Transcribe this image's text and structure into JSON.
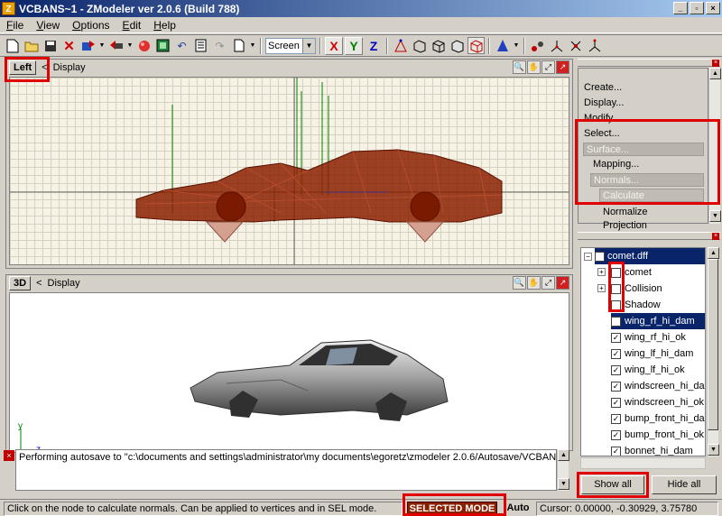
{
  "window": {
    "title": "VCBANS~1 - ZModeler ver 2.0.6 (Build 788)",
    "app_icon": "Z"
  },
  "menu": [
    {
      "label": "File",
      "u": "F",
      "rest": "ile"
    },
    {
      "label": "View",
      "u": "V",
      "rest": "iew"
    },
    {
      "label": "Options",
      "u": "O",
      "rest": "ptions"
    },
    {
      "label": "Edit",
      "u": "E",
      "rest": "dit"
    },
    {
      "label": "Help",
      "u": "H",
      "rest": "elp"
    }
  ],
  "toolbar": {
    "coord_mode": "Screen",
    "axis_x": "X",
    "axis_y": "Y",
    "axis_z": "Z"
  },
  "viewport_top": {
    "label": "Left",
    "display_label": "Display"
  },
  "viewport_bottom": {
    "label": "3D",
    "display_label": "Display"
  },
  "commands": {
    "create": "Create...",
    "display": "Display...",
    "modify": "Modify...",
    "select": "Select...",
    "surface": "Surface...",
    "mapping": "Mapping...",
    "normals": "Normals...",
    "calculate": "Calculate",
    "normalize": "Normalize",
    "projection": "Projection"
  },
  "tree": {
    "root": "comet.dff",
    "items": [
      {
        "label": "comet",
        "checked": false,
        "expandable": true
      },
      {
        "label": "Collision",
        "checked": false,
        "expandable": true
      },
      {
        "label": "Shadow",
        "checked": false,
        "expandable": false
      },
      {
        "label": "wing_rf_hi_dam",
        "checked": true,
        "selected": true
      },
      {
        "label": "wing_rf_hi_ok",
        "checked": true
      },
      {
        "label": "wing_lf_hi_dam",
        "checked": true
      },
      {
        "label": "wing_lf_hi_ok",
        "checked": true
      },
      {
        "label": "windscreen_hi_dam",
        "checked": true
      },
      {
        "label": "windscreen_hi_ok",
        "checked": true
      },
      {
        "label": "bump_front_hi_dam",
        "checked": true
      },
      {
        "label": "bump_front_hi_ok",
        "checked": true
      },
      {
        "label": "bonnet_hi_dam",
        "checked": true
      }
    ]
  },
  "buttons": {
    "show_all": "Show all",
    "hide_all": "Hide all"
  },
  "log": {
    "message": "Performing autosave to \"c:\\documents and settings\\administrator\\my documents\\egoretz\\zmodeler 2.0.6/Autosave/VCBANS"
  },
  "status": {
    "hint": "Click on the node to calculate normals. Can be applied to vertices and in SEL mode.",
    "mode": "SELECTED MODE",
    "auto": "Auto",
    "cursor": "Cursor: 0.00000, -0.30929, 3.75780"
  },
  "colors": {
    "title_start": "#0a246a",
    "title_end": "#a6caf0",
    "selection": "#0a246a",
    "highlight": "#e00000",
    "wireframe": "#8b2000"
  }
}
